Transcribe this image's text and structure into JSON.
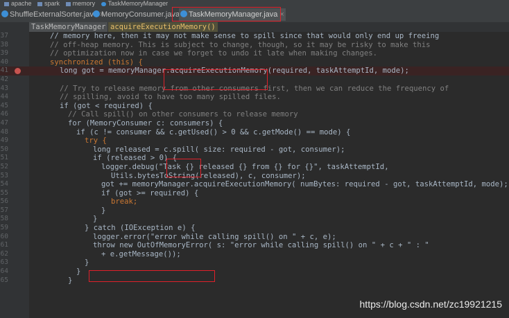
{
  "breadcrumbs": [
    "apache",
    "spark",
    "memory",
    "TaskMemoryManager"
  ],
  "tabs": [
    {
      "label": "ShuffleExternalSorter.java",
      "active": false
    },
    {
      "label": "MemoryConsumer.java",
      "active": false
    },
    {
      "label": "TaskMemoryManager.java",
      "active": true
    }
  ],
  "structure_crumbs": {
    "class": "TaskMemoryManager",
    "method": "acquireExecutionMemory()"
  },
  "code_lines": [
    {
      "n": "37",
      "t": "// memory here, then it may not make sense to spill since that would only end up freeing"
    },
    {
      "n": "38",
      "t": "// off-heap memory. This is subject to change, though, so it may be risky to make this"
    },
    {
      "n": "39",
      "t": "// optimization now in case we forget to undo it late when making changes."
    },
    {
      "n": "40",
      "t": "synchronized (this) {"
    },
    {
      "n": "41",
      "t": "long got = memoryManager.acquireExecutionMemory(required, taskAttemptId, mode);"
    },
    {
      "n": "42",
      "t": ""
    },
    {
      "n": "43",
      "t": "// Try to release memory from other consumers first, then we can reduce the frequency of"
    },
    {
      "n": "44",
      "t": "// spilling, avoid to have too many spilled files."
    },
    {
      "n": "45",
      "t": "if (got < required) {"
    },
    {
      "n": "46",
      "t": "// Call spill() on other consumers to release memory"
    },
    {
      "n": "47",
      "t": "for (MemoryConsumer c: consumers) {"
    },
    {
      "n": "48",
      "t": "if (c != consumer && c.getUsed() > 0 && c.getMode() == mode) {"
    },
    {
      "n": "49",
      "t": "try {"
    },
    {
      "n": "50",
      "t": "long released = c.spill( size: required - got, consumer);"
    },
    {
      "n": "51",
      "t": "if (released > 0) {"
    },
    {
      "n": "52",
      "t": "logger.debug(\"Task {} released {} from {} for {}\", taskAttemptId,"
    },
    {
      "n": "53",
      "t": "Utils.bytesToString(released), c, consumer);"
    },
    {
      "n": "54",
      "t": "got += memoryManager.acquireExecutionMemory( numBytes: required - got, taskAttemptId, mode);"
    },
    {
      "n": "55",
      "t": "if (got >= required) {"
    },
    {
      "n": "56",
      "t": "break;"
    },
    {
      "n": "57",
      "t": "}"
    },
    {
      "n": "58",
      "t": "}"
    },
    {
      "n": "59",
      "t": "} catch (IOException e) {"
    },
    {
      "n": "60",
      "t": "logger.error(\"error while calling spill() on \" + c, e);"
    },
    {
      "n": "61",
      "t": "throw new OutOfMemoryError( s: \"error while calling spill() on \" + c + \" : \""
    },
    {
      "n": "62",
      "t": "+ e.getMessage());"
    },
    {
      "n": "63",
      "t": "}"
    },
    {
      "n": "64",
      "t": "}"
    },
    {
      "n": "65",
      "t": "}"
    }
  ],
  "breakpoint_line": "41",
  "watermark": "https://blog.csdn.net/zc19921215",
  "colors": {
    "background": "#2b2b2b",
    "keyword": "#cc7832",
    "comment": "#808080",
    "string": "#6a8759",
    "field": "#9876aa",
    "highlight_box": "#e0202a"
  }
}
